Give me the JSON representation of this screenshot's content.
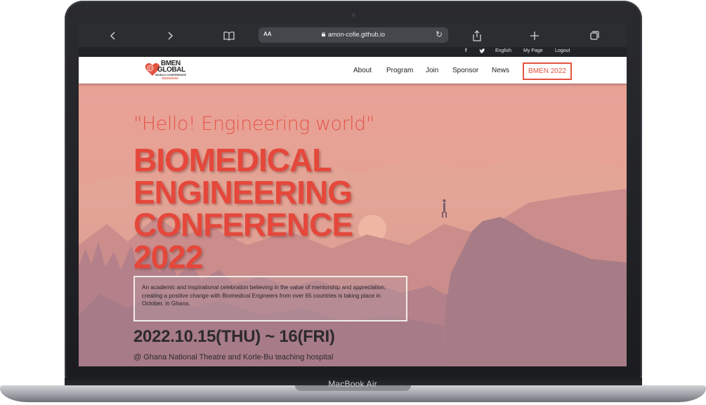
{
  "device": {
    "label": "MacBook Air"
  },
  "browser": {
    "text_size_label": "AA",
    "url": "amon-cofie.github.io",
    "icons": {
      "back": "chevron-left-icon",
      "forward": "chevron-right-icon",
      "bookmarks": "book-icon",
      "reload": "reload-icon",
      "share": "share-icon",
      "new_tab": "plus-icon",
      "tabs": "tabs-icon"
    }
  },
  "utility_bar": {
    "facebook": "f",
    "twitter_icon": "twitter-icon",
    "language": "English",
    "my_page": "My Page",
    "logout": "Logout"
  },
  "site": {
    "logo": {
      "title_line1": "BMEN",
      "title_line2": "GLOBAL",
      "subtitle": "WORLD CONFERENCE"
    },
    "nav": {
      "about": "About",
      "program": "Program",
      "join": "Join",
      "sponsor": "Sponsor",
      "news": "News",
      "highlight": "BMEN 2022"
    },
    "colors": {
      "accent": "#e4533f",
      "hero_top": "#e9a196",
      "hero_bottom": "#b9868c"
    }
  },
  "hero": {
    "tagline": "\"Hello! Engineering world\"",
    "headline": [
      "BIOMEDICAL",
      "ENGINEERING",
      "CONFERENCE",
      "2022"
    ],
    "description": "An academic and inspirational celebration believing in the value of mentorship and appreciation, creating a positive change with Biomedical Engineers from over 65 countries is taking place in October, in Ghana.",
    "dates": "2022.10.15(THU) ~ 16(FRI)",
    "venue": "@ Ghana National Theatre and Korle-Bu teaching hospital"
  }
}
